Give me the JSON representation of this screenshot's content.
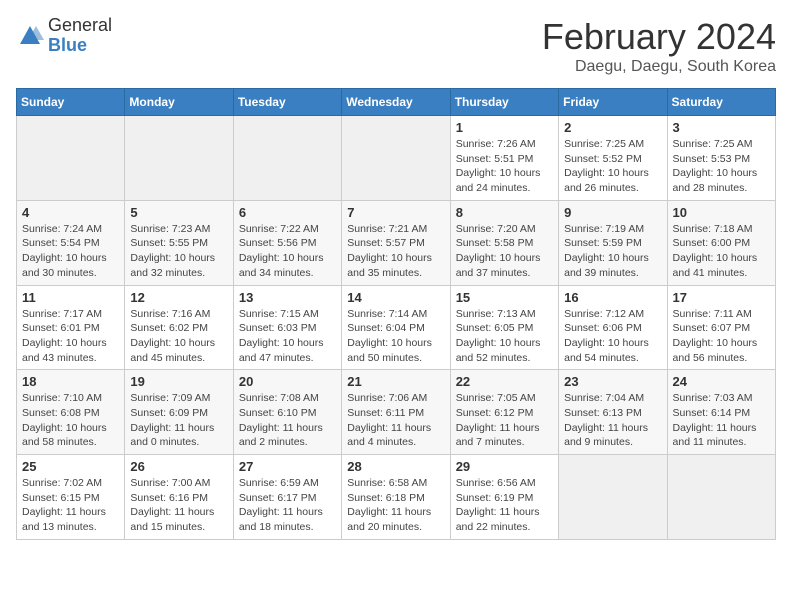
{
  "header": {
    "logo_general": "General",
    "logo_blue": "Blue",
    "month_title": "February 2024",
    "location": "Daegu, Daegu, South Korea"
  },
  "days_of_week": [
    "Sunday",
    "Monday",
    "Tuesday",
    "Wednesday",
    "Thursday",
    "Friday",
    "Saturday"
  ],
  "weeks": [
    [
      {
        "day": "",
        "info": ""
      },
      {
        "day": "",
        "info": ""
      },
      {
        "day": "",
        "info": ""
      },
      {
        "day": "",
        "info": ""
      },
      {
        "day": "1",
        "info": "Sunrise: 7:26 AM\nSunset: 5:51 PM\nDaylight: 10 hours and 24 minutes."
      },
      {
        "day": "2",
        "info": "Sunrise: 7:25 AM\nSunset: 5:52 PM\nDaylight: 10 hours and 26 minutes."
      },
      {
        "day": "3",
        "info": "Sunrise: 7:25 AM\nSunset: 5:53 PM\nDaylight: 10 hours and 28 minutes."
      }
    ],
    [
      {
        "day": "4",
        "info": "Sunrise: 7:24 AM\nSunset: 5:54 PM\nDaylight: 10 hours and 30 minutes."
      },
      {
        "day": "5",
        "info": "Sunrise: 7:23 AM\nSunset: 5:55 PM\nDaylight: 10 hours and 32 minutes."
      },
      {
        "day": "6",
        "info": "Sunrise: 7:22 AM\nSunset: 5:56 PM\nDaylight: 10 hours and 34 minutes."
      },
      {
        "day": "7",
        "info": "Sunrise: 7:21 AM\nSunset: 5:57 PM\nDaylight: 10 hours and 35 minutes."
      },
      {
        "day": "8",
        "info": "Sunrise: 7:20 AM\nSunset: 5:58 PM\nDaylight: 10 hours and 37 minutes."
      },
      {
        "day": "9",
        "info": "Sunrise: 7:19 AM\nSunset: 5:59 PM\nDaylight: 10 hours and 39 minutes."
      },
      {
        "day": "10",
        "info": "Sunrise: 7:18 AM\nSunset: 6:00 PM\nDaylight: 10 hours and 41 minutes."
      }
    ],
    [
      {
        "day": "11",
        "info": "Sunrise: 7:17 AM\nSunset: 6:01 PM\nDaylight: 10 hours and 43 minutes."
      },
      {
        "day": "12",
        "info": "Sunrise: 7:16 AM\nSunset: 6:02 PM\nDaylight: 10 hours and 45 minutes."
      },
      {
        "day": "13",
        "info": "Sunrise: 7:15 AM\nSunset: 6:03 PM\nDaylight: 10 hours and 47 minutes."
      },
      {
        "day": "14",
        "info": "Sunrise: 7:14 AM\nSunset: 6:04 PM\nDaylight: 10 hours and 50 minutes."
      },
      {
        "day": "15",
        "info": "Sunrise: 7:13 AM\nSunset: 6:05 PM\nDaylight: 10 hours and 52 minutes."
      },
      {
        "day": "16",
        "info": "Sunrise: 7:12 AM\nSunset: 6:06 PM\nDaylight: 10 hours and 54 minutes."
      },
      {
        "day": "17",
        "info": "Sunrise: 7:11 AM\nSunset: 6:07 PM\nDaylight: 10 hours and 56 minutes."
      }
    ],
    [
      {
        "day": "18",
        "info": "Sunrise: 7:10 AM\nSunset: 6:08 PM\nDaylight: 10 hours and 58 minutes."
      },
      {
        "day": "19",
        "info": "Sunrise: 7:09 AM\nSunset: 6:09 PM\nDaylight: 11 hours and 0 minutes."
      },
      {
        "day": "20",
        "info": "Sunrise: 7:08 AM\nSunset: 6:10 PM\nDaylight: 11 hours and 2 minutes."
      },
      {
        "day": "21",
        "info": "Sunrise: 7:06 AM\nSunset: 6:11 PM\nDaylight: 11 hours and 4 minutes."
      },
      {
        "day": "22",
        "info": "Sunrise: 7:05 AM\nSunset: 6:12 PM\nDaylight: 11 hours and 7 minutes."
      },
      {
        "day": "23",
        "info": "Sunrise: 7:04 AM\nSunset: 6:13 PM\nDaylight: 11 hours and 9 minutes."
      },
      {
        "day": "24",
        "info": "Sunrise: 7:03 AM\nSunset: 6:14 PM\nDaylight: 11 hours and 11 minutes."
      }
    ],
    [
      {
        "day": "25",
        "info": "Sunrise: 7:02 AM\nSunset: 6:15 PM\nDaylight: 11 hours and 13 minutes."
      },
      {
        "day": "26",
        "info": "Sunrise: 7:00 AM\nSunset: 6:16 PM\nDaylight: 11 hours and 15 minutes."
      },
      {
        "day": "27",
        "info": "Sunrise: 6:59 AM\nSunset: 6:17 PM\nDaylight: 11 hours and 18 minutes."
      },
      {
        "day": "28",
        "info": "Sunrise: 6:58 AM\nSunset: 6:18 PM\nDaylight: 11 hours and 20 minutes."
      },
      {
        "day": "29",
        "info": "Sunrise: 6:56 AM\nSunset: 6:19 PM\nDaylight: 11 hours and 22 minutes."
      },
      {
        "day": "",
        "info": ""
      },
      {
        "day": "",
        "info": ""
      }
    ]
  ]
}
